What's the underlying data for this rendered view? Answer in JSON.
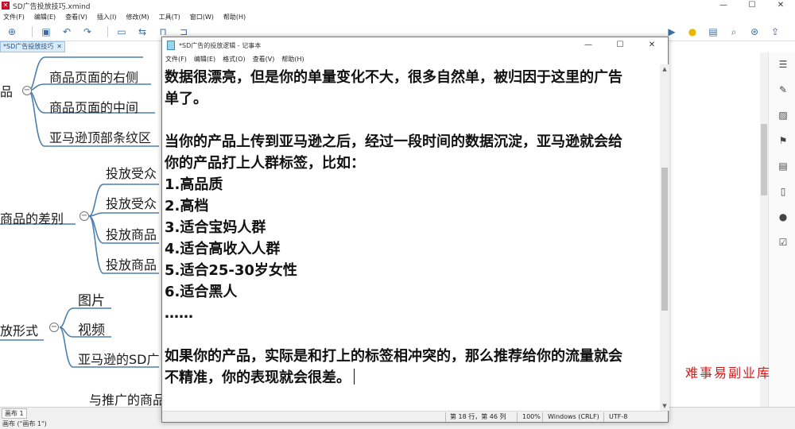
{
  "xmind": {
    "title": "SD广告投放技巧.xmind",
    "menu": [
      "文件(F)",
      "编辑(E)",
      "查看(V)",
      "插入(I)",
      "修改(M)",
      "工具(T)",
      "窗口(W)",
      "帮助(H)"
    ],
    "tab_label": "*SD广告投放技巧",
    "tab_close": "✕",
    "sheet_tab": "画布 1",
    "status": "画布 (\"画布 1\")"
  },
  "mindmap": {
    "nodes": [
      {
        "text": "品"
      },
      {
        "text": "商品页面的右侧"
      },
      {
        "text": "商品页面的中间"
      },
      {
        "text": "亚马逊顶部条纹区"
      },
      {
        "text": "商品的差别"
      },
      {
        "text": "投放受众"
      },
      {
        "text": "投放受众"
      },
      {
        "text": "投放商品"
      },
      {
        "text": "投放商品"
      },
      {
        "text": "放形式"
      },
      {
        "text": "图片"
      },
      {
        "text": "视频"
      },
      {
        "text": "亚马逊的SD广"
      },
      {
        "text": "与推广的商品"
      }
    ]
  },
  "notepad": {
    "title": "*SD广告的投放逻辑 - 记事本",
    "menu": [
      "文件(F)",
      "编辑(E)",
      "格式(O)",
      "查看(V)",
      "帮助(H)"
    ],
    "lines": [
      "数据很漂亮，但是你的单量变化不大，很多自然单，被归因于这里的广告",
      "单了。",
      "",
      "当你的产品上传到亚马逊之后，经过一段时间的数据沉淀，亚马逊就会给",
      "你的产品打上人群标签，比如：",
      "1.高品质",
      "2.高档",
      "3.适合宝妈人群",
      "4.适合高收入人群",
      "5.适合25-30岁女性",
      "6.适合黑人",
      "……",
      "",
      "如果你的产品，实际是和打上的标签相冲突的，那么推荐给你的流量就会",
      "不精准，你的表现就会很差。"
    ],
    "status": {
      "position": "第 18 行，第 46 列",
      "zoom": "100%",
      "line_ending": "Windows (CRLF)",
      "encoding": "UTF-8"
    }
  },
  "watermark": "难事易副业库",
  "colors": {
    "mindmap_line": "#4b7fb0",
    "tab_bg": "#dcebfa",
    "watermark": "#d81818"
  }
}
